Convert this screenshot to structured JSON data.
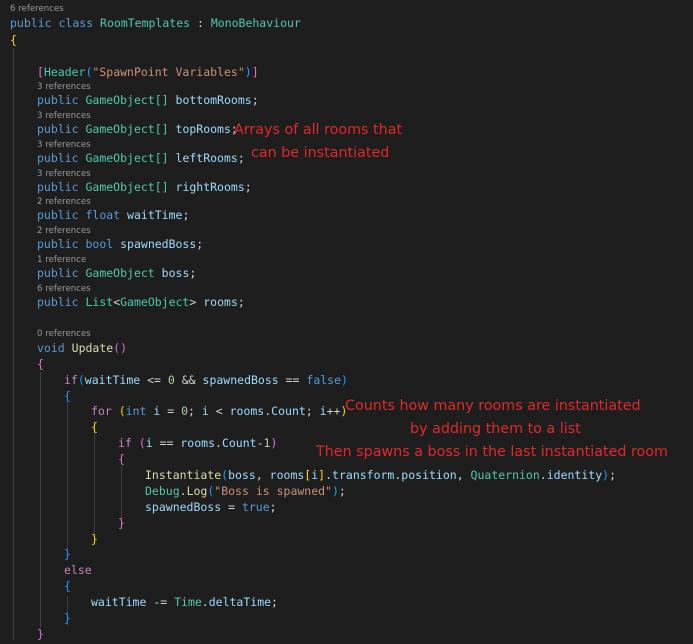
{
  "code_lens": {
    "class_refs": "6 references",
    "bottom_refs": "3 references",
    "top_refs": "3 references",
    "left_refs": "3 references",
    "right_refs": "3 references",
    "wait_refs": "2 references",
    "spawned_refs": "2 references",
    "boss_refs": "1 reference",
    "rooms_refs": "6 references",
    "update_refs": "0 references"
  },
  "code": {
    "public": "public",
    "class": "class",
    "class_name": "RoomTemplates",
    "colon": " : ",
    "base_class": "MonoBehaviour",
    "open_brace": "{",
    "close_brace": "}",
    "attr_open": "[",
    "attr_name": "Header",
    "paren_open": "(",
    "attr_string": "\"SpawnPoint Variables\"",
    "paren_close": ")",
    "attr_close": "]",
    "gameobject_array": "GameObject[]",
    "gameobject": "GameObject",
    "float": "float",
    "bool": "bool",
    "list_type": "List",
    "generic_open": "<",
    "generic_close": ">",
    "field_bottom": "bottomRooms",
    "field_top": "topRooms",
    "field_left": "leftRooms",
    "field_right": "rightRooms",
    "field_wait": "waitTime",
    "field_spawned": "spawnedBoss",
    "field_boss": "boss",
    "field_rooms": "rooms",
    "semicolon": ";",
    "void": "void",
    "update_method": "Update",
    "if": "if",
    "else": "else",
    "for": "for",
    "int": "int",
    "i": "i",
    "zero": "0",
    "one": "1",
    "false": "false",
    "true": "true",
    "op_le": " <= ",
    "op_and": " && ",
    "op_eqeq": " == ",
    "op_lt": " < ",
    "op_eq": " = ",
    "op_minus": "-",
    "op_inc": "++",
    "op_minus_eq": " -= ",
    "semi_space": "; ",
    "comma_space": ", ",
    "dot": ".",
    "space": " ",
    "count": "Count",
    "instantiate": "Instantiate",
    "bracket_open": "[",
    "bracket_close": "]",
    "transform": "transform",
    "position": "position",
    "quaternion": "Quaternion",
    "identity": "identity",
    "debug": "Debug",
    "log": "Log",
    "log_string": "\"Boss is spawned\"",
    "time_class": "Time",
    "delta_time": "deltaTime"
  },
  "annotations": {
    "arrays_line1": "Arrays of all rooms that",
    "arrays_line2": "can be instantiated",
    "counts_line1": "Counts how many rooms are instantiated",
    "counts_line2": "by adding them to a list",
    "counts_line3": "Then spawns a boss in the last instantiated room"
  },
  "colors": {
    "background": "#1e1e1e",
    "keyword": "#569cd6",
    "control_keyword": "#c586c0",
    "type": "#4ec9b0",
    "method": "#dcdcaa",
    "string": "#ce9178",
    "variable": "#9cdcfe",
    "number": "#b5cea8",
    "annotation": "#e02a2a",
    "bracket_gold": "#ffd700",
    "bracket_orchid": "#da70d6",
    "bracket_blue": "#179fff"
  }
}
